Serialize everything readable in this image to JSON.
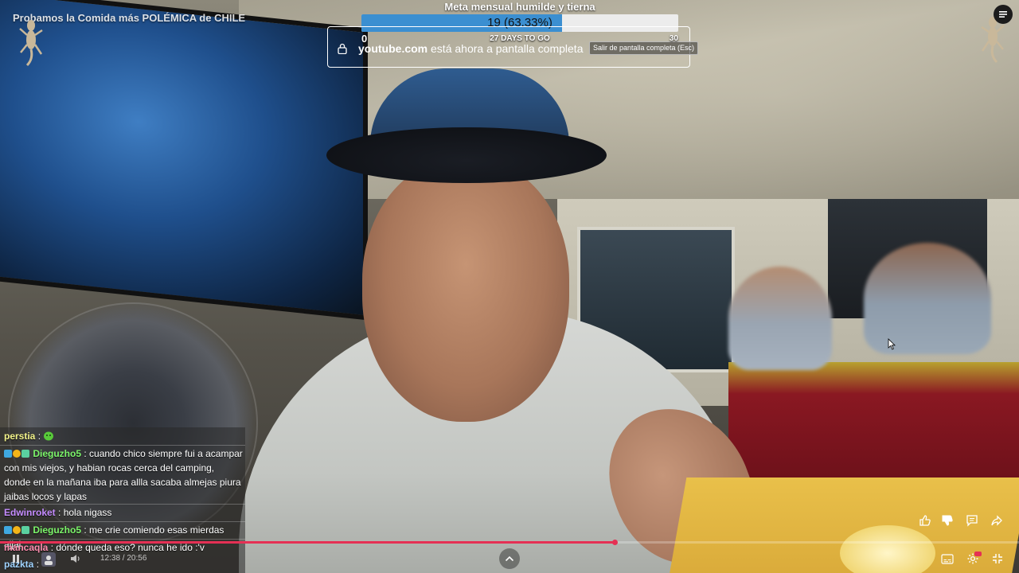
{
  "video": {
    "title": "Probamos la Comida más POLÉMICA de CHILE"
  },
  "goal": {
    "title": "Meta mensual humilde y tierna",
    "value_text": "19 (63.33%)",
    "progress_fraction": 0.6333,
    "min_label": "0",
    "days_label": "27 DAYS TO GO",
    "max_label": "30",
    "bar_color": "#3b8fd1"
  },
  "fullscreen_notice": {
    "domain": "youtube.com",
    "message": " está ahora a pantalla completa",
    "exit_label": "Salir de pantalla completa (Esc)"
  },
  "chat": {
    "messages": [
      {
        "user": "perstia",
        "separator": " : ",
        "text": "",
        "user_color": "#f3f38a",
        "emote": "green-face-emote"
      },
      {
        "user": "Dieguzho5",
        "separator": " : ",
        "text": "cuando chico siempre fui a acampar con mis viejos, y habian rocas cerca del camping, donde en la mañana iba para allla sacaba almejas piura jaibas locos y lapas",
        "user_color": "#7cf56a"
      },
      {
        "user": "Edwinroket",
        "separator": " : ",
        "text": "hola nigass",
        "user_color": "#c58cff"
      },
      {
        "user": "Dieguzho5",
        "separator": " : ",
        "text": "me crie comiendo esas mierdas ajjaj",
        "user_color": "#7cf56a"
      },
      {
        "user": "mancaqla",
        "separator": " : ",
        "text": "dónde queda eso? nunca he ido :'v",
        "user_color": "#ff8fb0"
      },
      {
        "user": "pazkta",
        "separator": " :",
        "text": "",
        "user_color": "#9fd3ff"
      }
    ]
  },
  "player": {
    "time_text": "12:38 / 20:56",
    "progress_fraction": 0.6035,
    "progress_color": "#e53054"
  },
  "icons": {
    "menu": "queue-menu-icon",
    "like": "thumbs-up-icon",
    "dislike": "thumbs-down-icon",
    "comment": "comment-icon",
    "share": "share-icon",
    "subtitles": "subtitles-icon",
    "settings": "gear-icon",
    "exit_fullscreen": "exit-fullscreen-icon",
    "pause": "pause-icon",
    "volume": "volume-icon",
    "expand": "chevron-up-icon"
  }
}
